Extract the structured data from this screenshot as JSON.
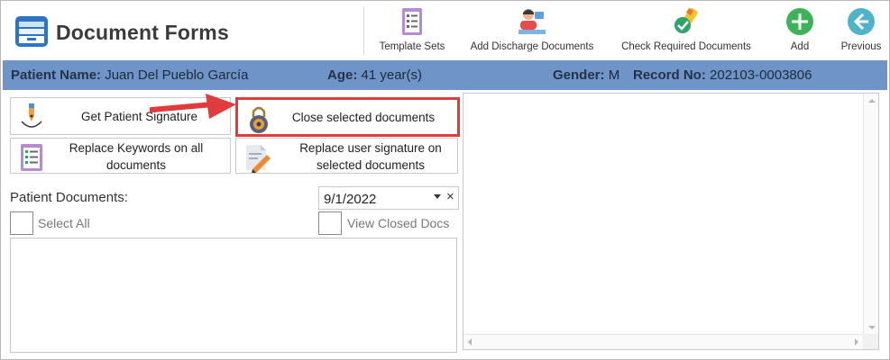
{
  "app": {
    "title": "Document Forms"
  },
  "toolbar": {
    "template_sets": "Template Sets",
    "add_discharge": "Add Discharge Documents",
    "check_required": "Check Required Documents",
    "add": "Add",
    "previous": "Previous"
  },
  "patient": {
    "name_label": "Patient Name:",
    "name_value": "Juan Del Pueblo García",
    "age_label": "Age:",
    "age_value": "41 year(s)",
    "gender_label": "Gender:",
    "gender_value": "M",
    "record_label": "Record No:",
    "record_value": "202103-0003806"
  },
  "actions": {
    "get_signature": "Get Patient Signature",
    "close_selected": "Close selected documents",
    "replace_keywords_l1": "Replace Keywords on all",
    "replace_keywords_l2": "documents",
    "replace_signature_l1": "Replace user signature on",
    "replace_signature_l2": "selected documents"
  },
  "documents": {
    "label": "Patient Documents:",
    "date": "9/1/2022",
    "clear_glyph": "×",
    "select_all": "Select All",
    "view_closed": "View Closed Docs"
  },
  "colors": {
    "patient_bar": "#6f94c8",
    "highlight": "#e03a3a",
    "add_green": "#3cb35a",
    "previous_teal": "#4fb3c9"
  }
}
